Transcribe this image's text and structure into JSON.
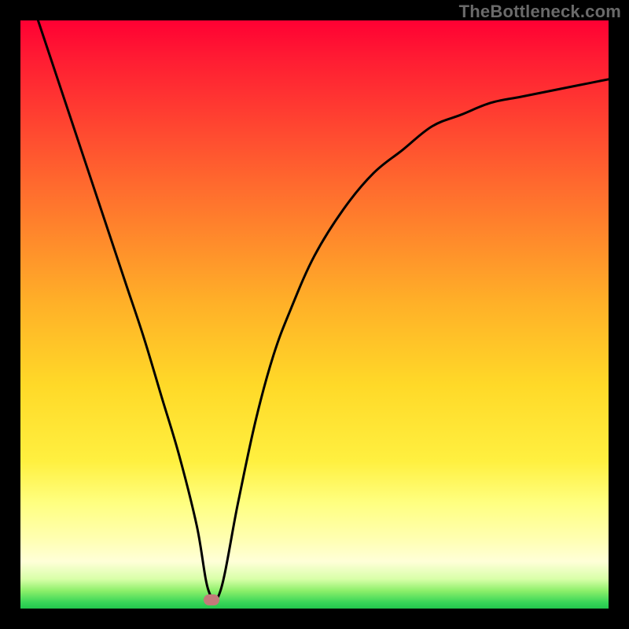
{
  "watermark": "TheBottleneck.com",
  "chart_data": {
    "type": "line",
    "title": "",
    "xlabel": "",
    "ylabel": "",
    "xlim": [
      0,
      100
    ],
    "ylim": [
      0,
      100
    ],
    "legend": false,
    "grid": false,
    "note": "Axes are percentage-like with no visible tick labels; values estimated from pixel positions.",
    "background_gradient": {
      "orientation": "vertical",
      "stops": [
        {
          "pos": 0,
          "color": "#ff0033"
        },
        {
          "pos": 28,
          "color": "#ff6a2e"
        },
        {
          "pos": 62,
          "color": "#ffd928"
        },
        {
          "pos": 88,
          "color": "#ffffb0"
        },
        {
          "pos": 99,
          "color": "#37d558"
        },
        {
          "pos": 100,
          "color": "#23c64d"
        }
      ]
    },
    "series": [
      {
        "name": "bottleneck-curve",
        "color": "#000000",
        "x": [
          3,
          6,
          9,
          12,
          15,
          18,
          21,
          24,
          27,
          30,
          32,
          34,
          37,
          40,
          43,
          46,
          50,
          55,
          60,
          65,
          70,
          75,
          80,
          85,
          90,
          95,
          100
        ],
        "y": [
          100,
          91,
          82,
          73,
          64,
          55,
          46,
          36,
          26,
          14,
          3,
          3,
          18,
          32,
          43,
          51,
          60,
          68,
          74,
          78,
          82,
          84,
          86,
          87,
          88,
          89,
          90
        ]
      }
    ],
    "marker": {
      "x": 32.5,
      "y": 1.5,
      "color": "#c37a7a"
    }
  }
}
